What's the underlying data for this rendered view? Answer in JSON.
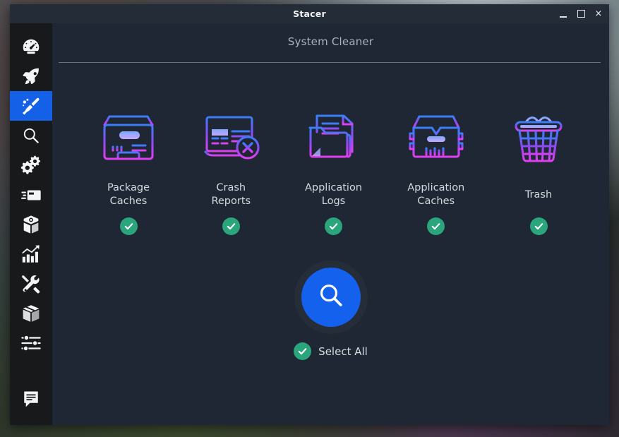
{
  "window": {
    "title": "Stacer",
    "controls": {
      "minimize": "minimize-icon",
      "maximize": "maximize-icon",
      "close": "×"
    }
  },
  "page": {
    "title": "System Cleaner"
  },
  "colors": {
    "accent_blue": "#1461ee",
    "active_nav": "#1461e8",
    "check_green": "#2aa57c",
    "icon_gradient_start": "#3b7ef6",
    "icon_gradient_end": "#e03ff0",
    "window_bg": "#1e2733",
    "titlebar_bg": "#232c37",
    "sidebar_bg": "#17191b",
    "label_text": "#d3d8dd",
    "page_title_text": "#aab3bd"
  },
  "sidebar": {
    "items": [
      {
        "name": "dashboard",
        "icon": "speedometer-icon",
        "active": false
      },
      {
        "name": "startup-apps",
        "icon": "rocket-icon",
        "active": false
      },
      {
        "name": "system-cleaner",
        "icon": "broom-icon",
        "active": true
      },
      {
        "name": "search",
        "icon": "magnifier-icon",
        "active": false
      },
      {
        "name": "services",
        "icon": "gears-icon",
        "active": false
      },
      {
        "name": "processes",
        "icon": "cards-icon",
        "active": false
      },
      {
        "name": "uninstaller",
        "icon": "package-open-icon",
        "active": false
      },
      {
        "name": "resources",
        "icon": "bar-chart-icon",
        "active": false
      },
      {
        "name": "tools",
        "icon": "tools-icon",
        "active": false
      },
      {
        "name": "packages",
        "icon": "box-icon",
        "active": false
      },
      {
        "name": "settings",
        "icon": "sliders-icon",
        "active": false
      },
      {
        "name": "feedback",
        "icon": "speech-bubble-icon",
        "active": false
      }
    ]
  },
  "cleaner": {
    "cards": [
      {
        "label_line1": "Package",
        "label_line2": "Caches",
        "icon": "package-caches-icon",
        "checked": true
      },
      {
        "label_line1": "Crash",
        "label_line2": "Reports",
        "icon": "crash-reports-icon",
        "checked": true
      },
      {
        "label_line1": "Application",
        "label_line2": "Logs",
        "icon": "application-logs-icon",
        "checked": true
      },
      {
        "label_line1": "Application",
        "label_line2": "Caches",
        "icon": "application-caches-icon",
        "checked": true
      },
      {
        "label_line1": "Trash",
        "label_line2": "",
        "icon": "trash-icon",
        "checked": true
      }
    ],
    "scan_button": {
      "icon": "magnifier-icon",
      "label": ""
    },
    "select_all": {
      "label": "Select All",
      "checked": true
    }
  }
}
